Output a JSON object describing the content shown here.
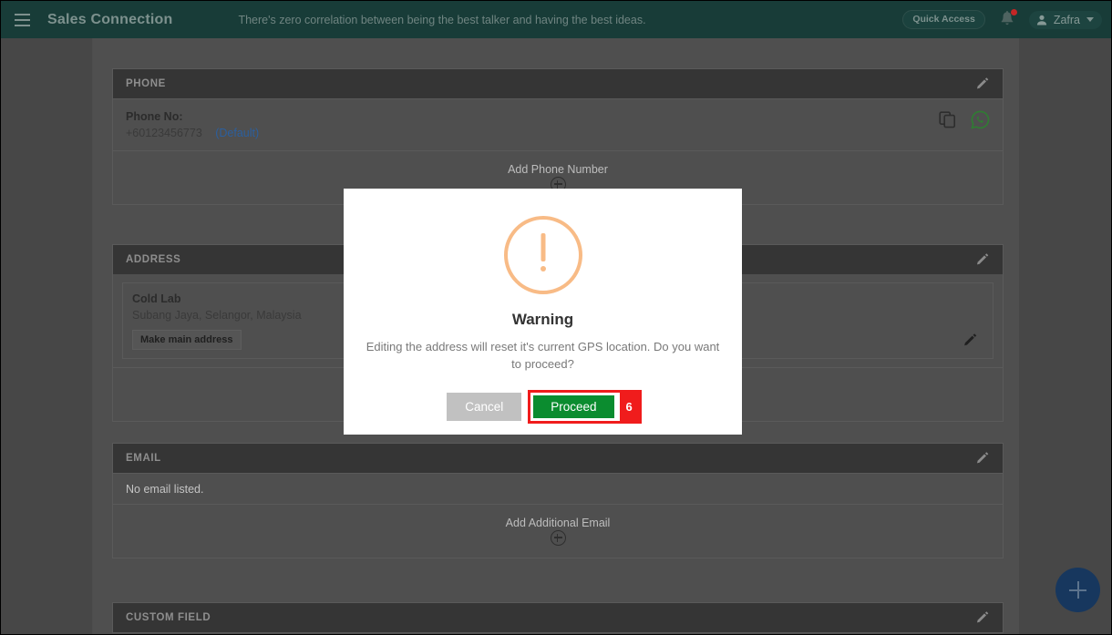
{
  "topbar": {
    "menu_icon": "hamburger-icon",
    "brand": "Sales Connection",
    "tagline": "There's zero correlation between being the best talker and having the best ideas.",
    "quick_access_label": "Quick Access",
    "bell_icon": "bell-icon",
    "user_name": "Zafra",
    "brand_color": "#183c38"
  },
  "sections": {
    "phone": {
      "header": "PHONE",
      "edit_icon": "pencil-icon",
      "label": "Phone No:",
      "number": "+60123456773",
      "default_tag": "(Default)",
      "copy_icon": "copy-icon",
      "whatsapp_icon": "whatsapp-icon",
      "add_label": "Add Phone Number",
      "add_icon": "plus-circle-icon"
    },
    "address": {
      "header": "ADDRESS",
      "edit_icon": "pencil-icon",
      "name": "Cold Lab",
      "location": "Subang Jaya, Selangor, Malaysia",
      "make_main_label": "Make main address",
      "row_edit_icon": "pencil-icon"
    },
    "email": {
      "header": "EMAIL",
      "edit_icon": "pencil-icon",
      "empty_text": "No email listed.",
      "add_label": "Add Additional Email",
      "add_icon": "plus-circle-icon"
    },
    "custom_field": {
      "header": "CUSTOM FIELD",
      "edit_icon": "pencil-icon"
    }
  },
  "fab": {
    "icon": "plus-icon",
    "color": "#17375e"
  },
  "modal": {
    "icon": "warning-exclamation-icon",
    "icon_color": "#f8bb86",
    "title": "Warning",
    "message": "Editing the address will reset it's current GPS location. Do you want to proceed?",
    "cancel_label": "Cancel",
    "proceed_label": "Proceed",
    "proceed_color": "#0b8c2f",
    "step_badge": "6",
    "highlight_color": "#f01c1c"
  }
}
